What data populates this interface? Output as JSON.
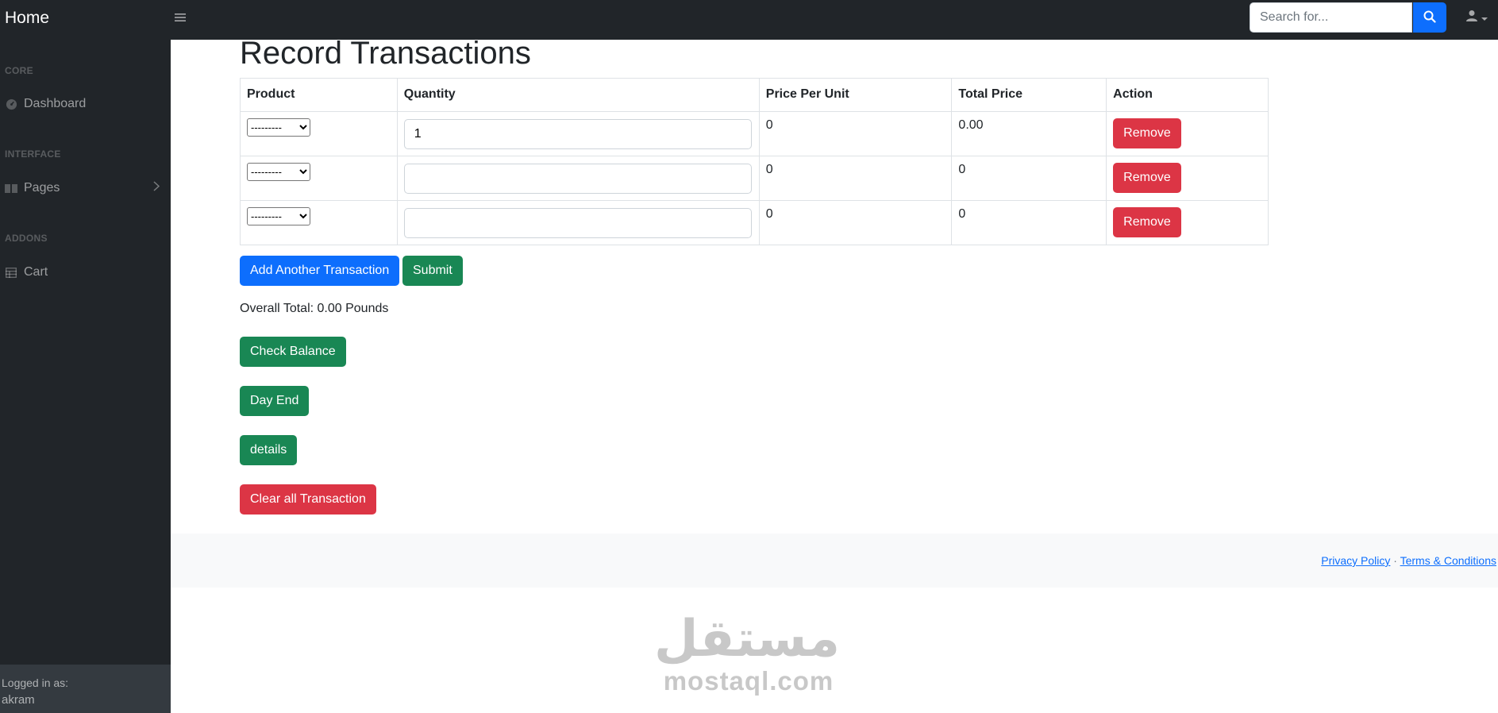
{
  "navbar": {
    "brand": "Home",
    "toggle_icon": "bars-icon",
    "search_placeholder": "Search for..."
  },
  "sidebar": {
    "sections": [
      {
        "heading": "CORE",
        "items": [
          {
            "label": "Dashboard",
            "icon": "tachometer-icon"
          }
        ]
      },
      {
        "heading": "INTERFACE",
        "items": [
          {
            "label": "Pages",
            "icon": "book-open-icon"
          }
        ]
      },
      {
        "heading": "ADDONS",
        "items": [
          {
            "label": "Cart",
            "icon": "table-icon"
          }
        ]
      }
    ],
    "footer": {
      "label": "Logged in as:",
      "user": "akram"
    }
  },
  "main": {
    "title": "Record Transactions",
    "table": {
      "headers": [
        "Product",
        "Quantity",
        "Price Per Unit",
        "Total Price",
        "Action"
      ],
      "rows": [
        {
          "product": "---------",
          "quantity": "1",
          "price_per_unit": "0",
          "total_price": "0.00",
          "action": "Remove"
        },
        {
          "product": "---------",
          "quantity": "",
          "price_per_unit": "0",
          "total_price": "0",
          "action": "Remove"
        },
        {
          "product": "---------",
          "quantity": "",
          "price_per_unit": "0",
          "total_price": "0",
          "action": "Remove"
        }
      ]
    },
    "buttons": {
      "add_transaction": "Add Another Transaction",
      "submit": "Submit",
      "check_balance": "Check Balance",
      "day_end": "Day End",
      "details": "details",
      "clear_all": "Clear all Transaction"
    },
    "overall_total": "Overall Total: 0.00 Pounds"
  },
  "footer": {
    "privacy": "Privacy Policy",
    "separator": "·",
    "terms": "Terms & Conditions"
  },
  "watermark": {
    "arabic": "مستقل",
    "latin": "mostaql.com"
  },
  "colors": {
    "dark": "#212529",
    "primary": "#0d6efd",
    "success": "#198754",
    "danger": "#dc3545"
  }
}
